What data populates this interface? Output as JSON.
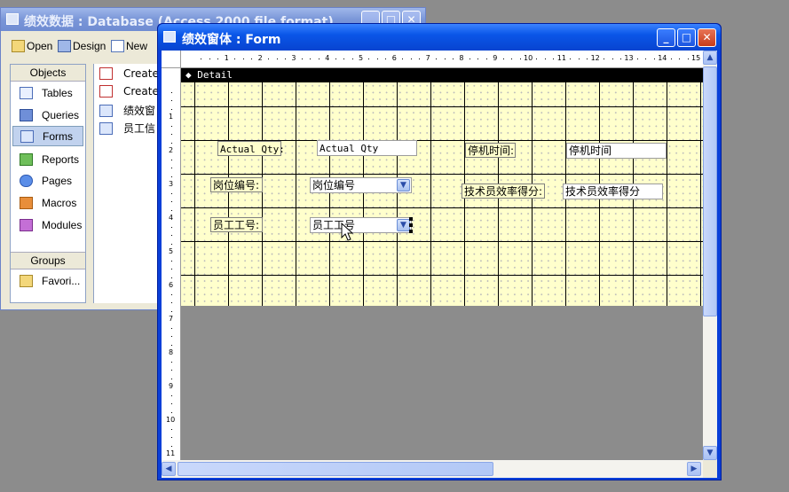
{
  "db_window": {
    "title": "绩效数据 : Database (Access 2000 file format)",
    "toolbar": {
      "open": "Open",
      "design": "Design",
      "new": "New"
    },
    "objects_header": "Objects",
    "objects": [
      {
        "label": "Tables",
        "icon": "table-icon"
      },
      {
        "label": "Queries",
        "icon": "query-icon"
      },
      {
        "label": "Forms",
        "icon": "form-icon"
      },
      {
        "label": "Reports",
        "icon": "report-icon"
      },
      {
        "label": "Pages",
        "icon": "page-icon"
      },
      {
        "label": "Macros",
        "icon": "macro-icon"
      },
      {
        "label": "Modules",
        "icon": "module-icon"
      }
    ],
    "selected_object": "Forms",
    "groups_header": "Groups",
    "groups": [
      {
        "label": "Favori..."
      }
    ],
    "list_items": [
      {
        "label": "Create",
        "icon": "create-wizard-icon"
      },
      {
        "label": "Create",
        "icon": "create-design-icon"
      },
      {
        "label": "绩效窗",
        "icon": "form-icon"
      },
      {
        "label": "员工信",
        "icon": "form-icon"
      }
    ]
  },
  "form_window": {
    "title": "绩效窗体 : Form",
    "section_label": "Detail",
    "h_ruler_numbers": [
      "1",
      "2",
      "3",
      "4",
      "5",
      "6",
      "7",
      "8",
      "9",
      "10",
      "11",
      "12",
      "13",
      "14",
      "15"
    ],
    "v_ruler_numbers": [
      "1",
      "2",
      "3",
      "4",
      "5",
      "6",
      "7",
      "8",
      "9",
      "10",
      "11"
    ],
    "controls": {
      "actual_qty_label": "Actual Qty:",
      "actual_qty_field": "Actual Qty",
      "downtime_label": "停机时间:",
      "downtime_field": "停机时间",
      "position_label": "岗位编号:",
      "position_field": "岗位编号",
      "tech_score_label": "技术员效率得分:",
      "tech_score_field": "技术员效率得分",
      "employee_label": "员工工号:",
      "employee_field": "员工工号"
    }
  },
  "colors": {
    "detail_background": "#ffffcc",
    "titlebar_active": "#0a56e8",
    "desktop": "#8c8c8c"
  }
}
